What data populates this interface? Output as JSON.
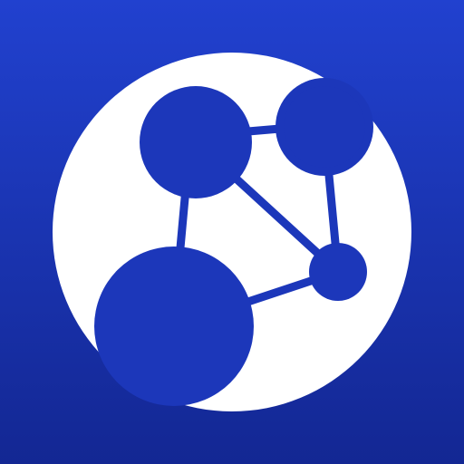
{
  "icon": {
    "name": "network-graph-logo",
    "background_top_color": "#2141cf",
    "background_bottom_color": "#132793",
    "globe_color": "#ffffff",
    "node_color": "#1c37ba"
  }
}
